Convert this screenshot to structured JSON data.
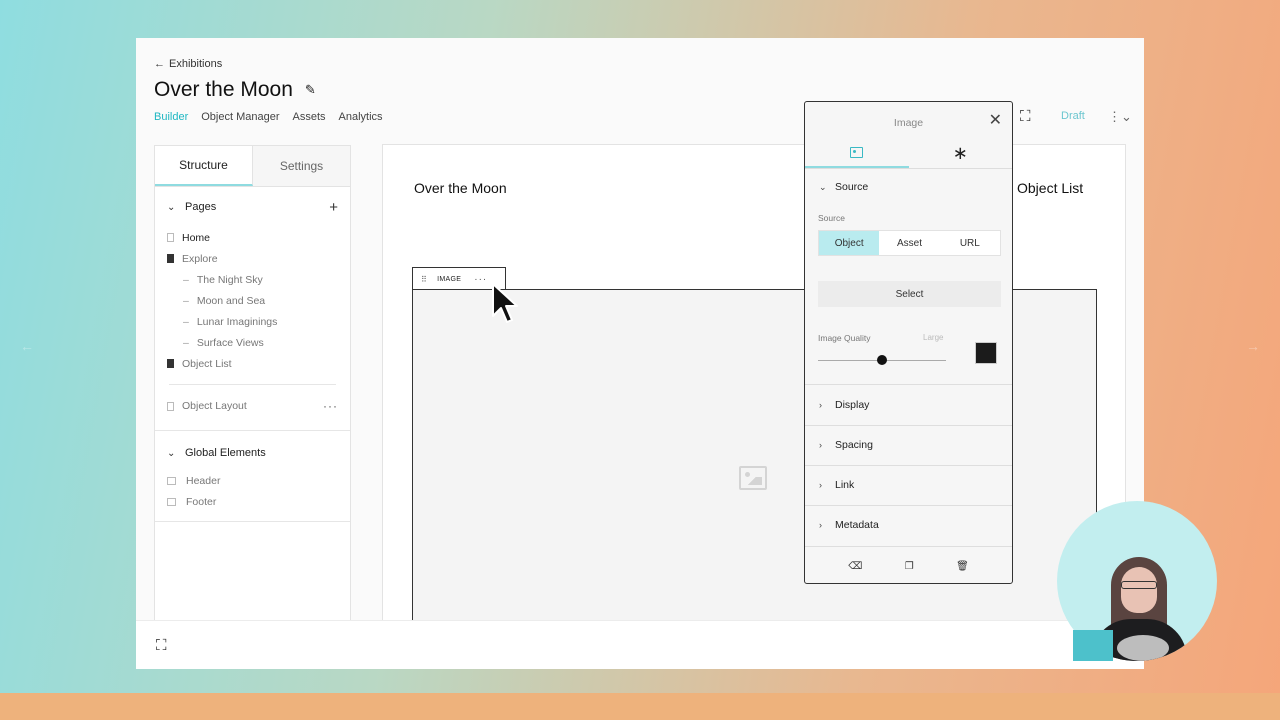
{
  "back_link": "Exhibitions",
  "title": "Over the Moon",
  "top_tabs": [
    "Builder",
    "Object Manager",
    "Assets",
    "Analytics"
  ],
  "status": "Draft",
  "left_panel": {
    "tabs": [
      "Structure",
      "Settings"
    ],
    "pages_label": "Pages",
    "pages": [
      {
        "label": "Home"
      },
      {
        "label": "Explore"
      },
      {
        "label": "The Night Sky"
      },
      {
        "label": "Moon and Sea"
      },
      {
        "label": "Lunar Imaginings"
      },
      {
        "label": "Surface Views"
      },
      {
        "label": "Object List"
      }
    ],
    "layout_item": "Object Layout",
    "global_label": "Global Elements",
    "global_items": [
      "Header",
      "Footer"
    ]
  },
  "canvas": {
    "title": "Over the Moon",
    "right_title": "Object List",
    "block_tag": "IMAGE"
  },
  "image_panel": {
    "title": "Image",
    "source_section": "Source",
    "source_label": "Source",
    "source_options": [
      "Object",
      "Asset",
      "URL"
    ],
    "source_selected": "Object",
    "select_button": "Select",
    "quality_label": "Image Quality",
    "quality_value": "Large",
    "quality_level": 0.5,
    "swatch_color": "#1b1b1b",
    "sections": [
      "Display",
      "Spacing",
      "Link",
      "Metadata"
    ]
  },
  "colors": {
    "accent": "#1fb7c2",
    "selected_bg": "#b9ebef"
  }
}
